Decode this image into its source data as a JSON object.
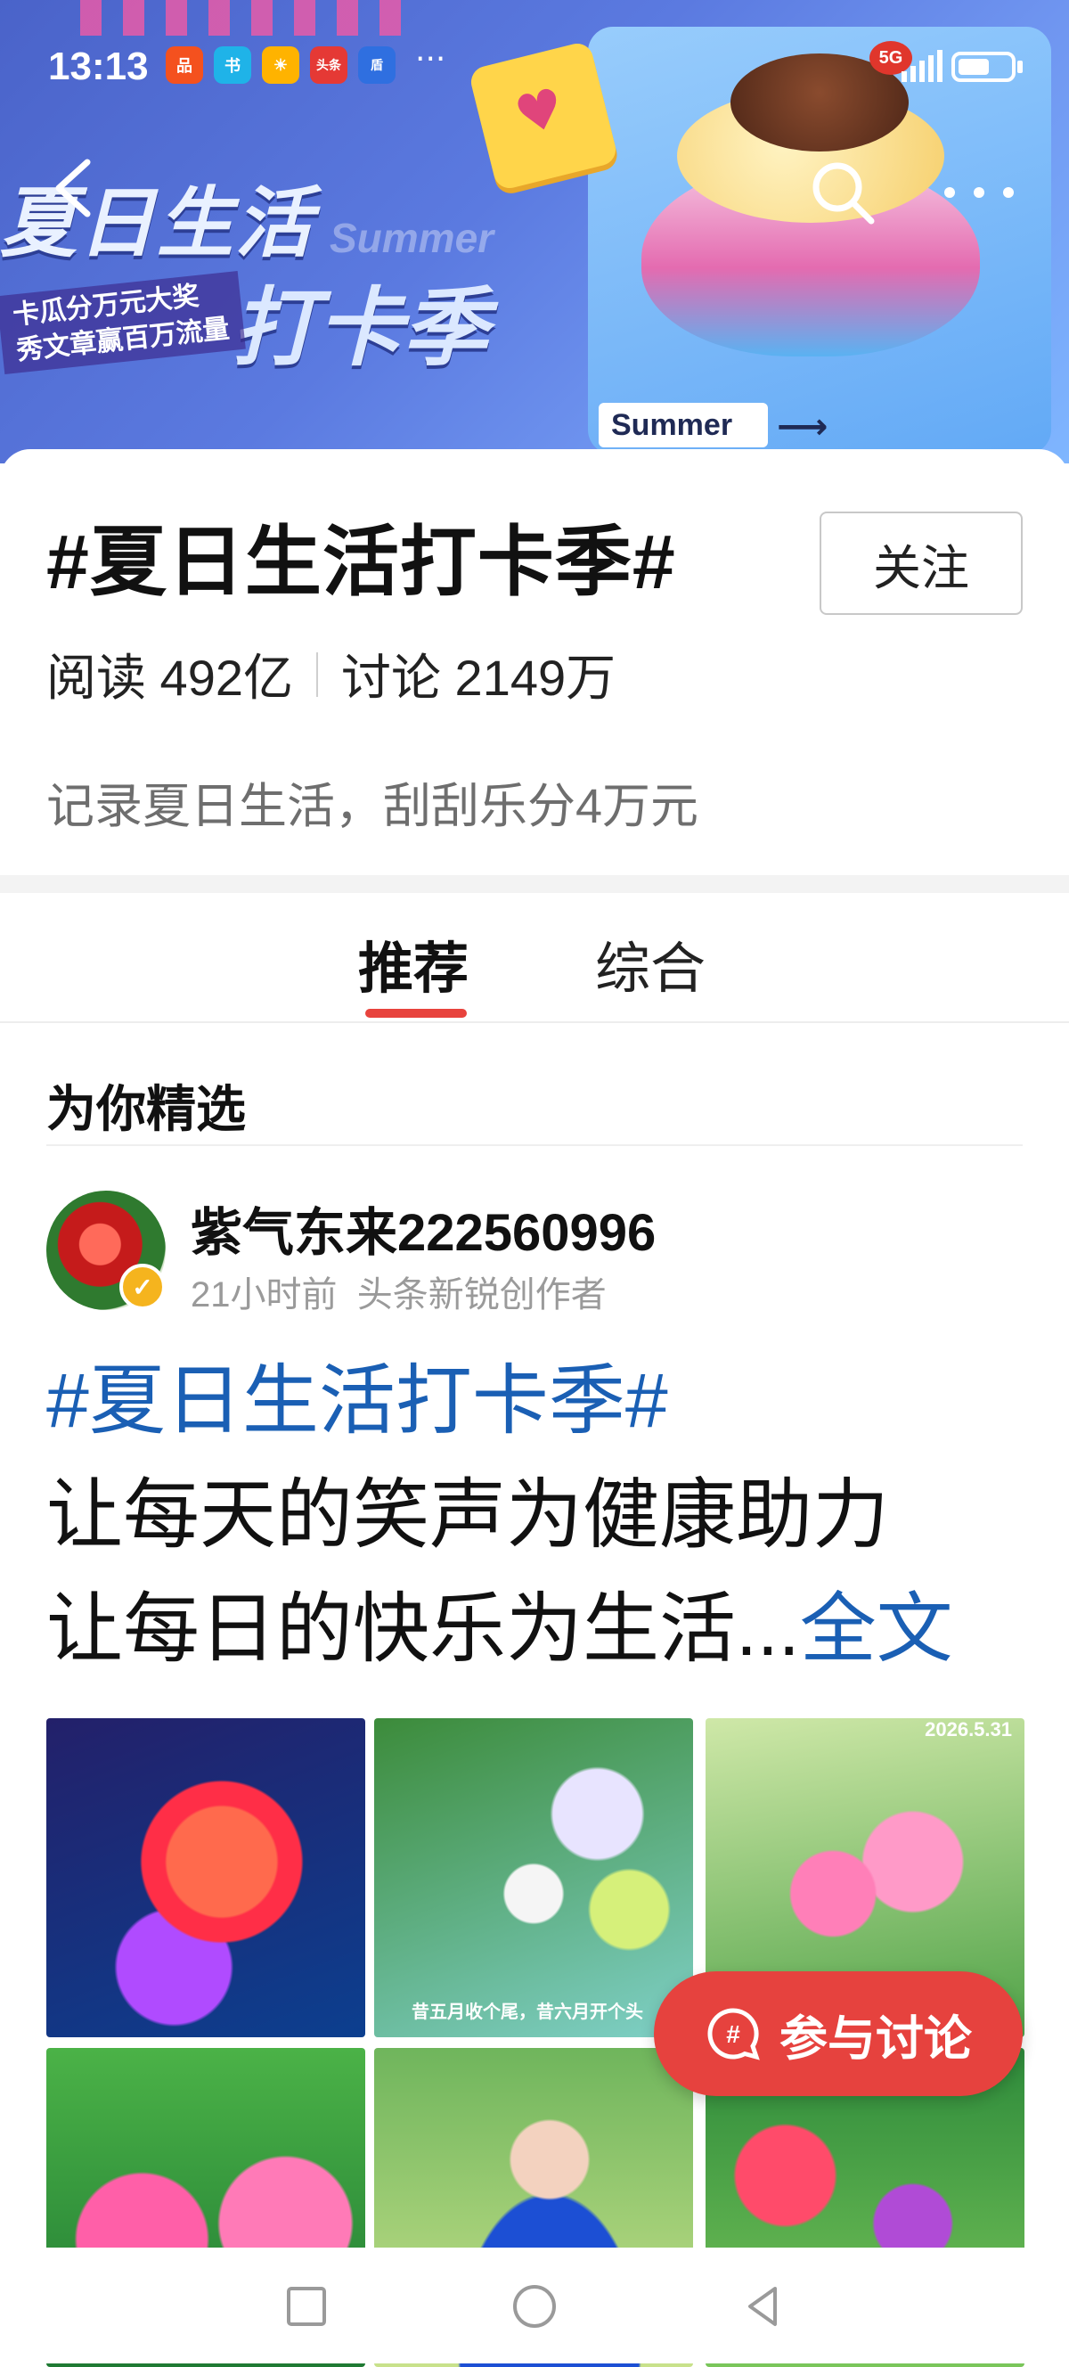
{
  "status_bar": {
    "time": "13:13",
    "network": "5G",
    "app_icons": [
      {
        "label": "品",
        "color": "#f4511e"
      },
      {
        "label": "书",
        "color": "#1fb3e8"
      },
      {
        "label": "☀",
        "color": "#ffb300"
      },
      {
        "label": "头条",
        "color": "#e53935"
      },
      {
        "label": "盾",
        "color": "#2f6fe0"
      }
    ],
    "battery_level": 0.6
  },
  "banner": {
    "headline": "夏日生活",
    "subline": "打卡季",
    "watermark": "Summer",
    "promo_line1": "卡瓜分万元大奖",
    "promo_line2": "秀文章赢百万流量",
    "sticker_label": "Summer"
  },
  "header": {
    "topic_title": "#夏日生活打卡季#",
    "follow_label": "关注",
    "reads_label": "阅读 492亿",
    "discussions_label": "讨论 2149万",
    "description": "记录夏日生活，刮刮乐分4万元"
  },
  "tabs": [
    {
      "label": "推荐",
      "active": true
    },
    {
      "label": "综合",
      "active": false
    }
  ],
  "feed": {
    "section_title": "为你精选",
    "post": {
      "author": "紫气东来222560996",
      "time_ago": "21小时前",
      "author_tag": "头条新锐创作者",
      "hashtag": "#夏日生活打卡季#",
      "line1": "让每天的笑声为健康助力",
      "line2": "让每日的快乐为生活...",
      "read_more": "全文",
      "image_caption": "昔五月收个尾，昔六月开个头",
      "image_date": "2026.5.31"
    }
  },
  "fab": {
    "label": "参与讨论"
  },
  "colors": {
    "accent": "#e6423e",
    "link": "#1a5fb4"
  }
}
